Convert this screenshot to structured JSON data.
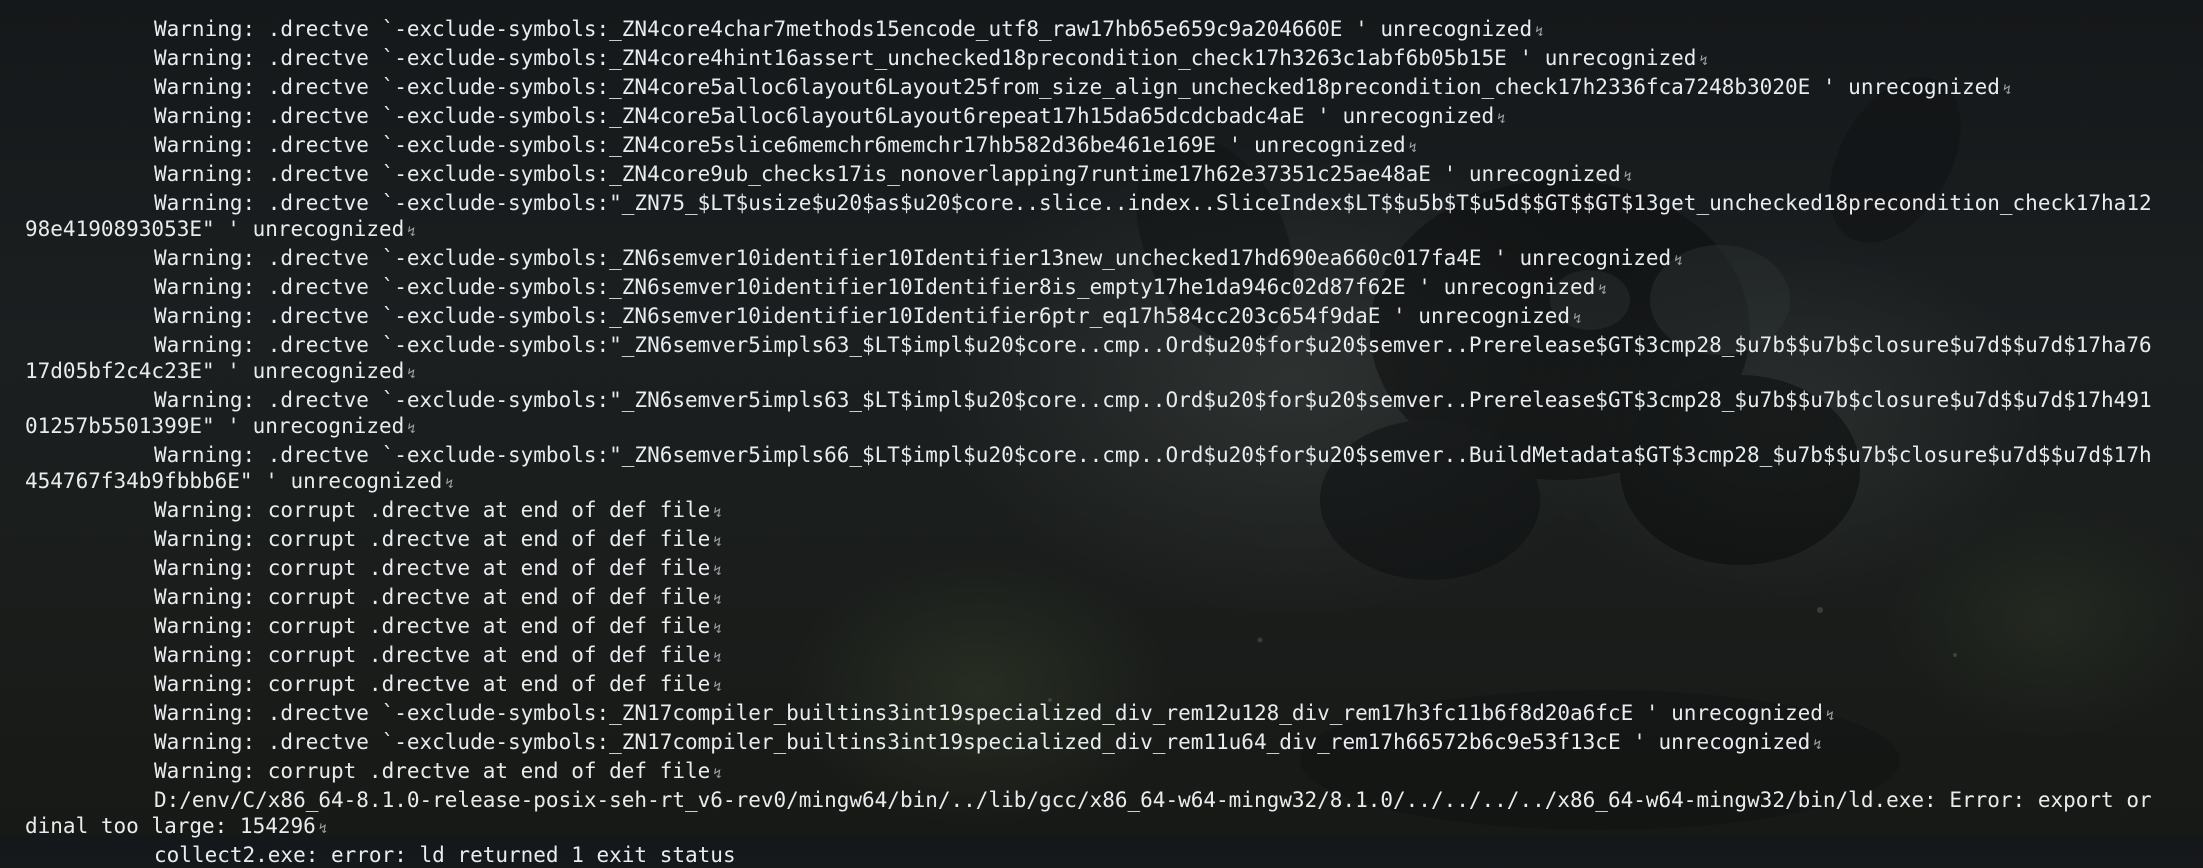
{
  "terminal": {
    "lines": [
      {
        "text": "Warning: .drectve `-exclude-symbols:_ZN4core4char7methods15encode_utf8_raw17hb65e659c9a204660E ' unrecognized",
        "eol": "↯"
      },
      {
        "text": "Warning: .drectve `-exclude-symbols:_ZN4core4hint16assert_unchecked18precondition_check17h3263c1abf6b05b15E ' unrecognized",
        "eol": "↯"
      },
      {
        "text": "Warning: .drectve `-exclude-symbols:_ZN4core5alloc6layout6Layout25from_size_align_unchecked18precondition_check17h2336fca7248b3020E ' unrecognized",
        "eol": "↯"
      },
      {
        "text": "Warning: .drectve `-exclude-symbols:_ZN4core5alloc6layout6Layout6repeat17h15da65dcdcbadc4aE ' unrecognized",
        "eol": "↯"
      },
      {
        "text": "Warning: .drectve `-exclude-symbols:_ZN4core5slice6memchr6memchr17hb582d36be461e169E ' unrecognized",
        "eol": "↯"
      },
      {
        "text": "Warning: .drectve `-exclude-symbols:_ZN4core9ub_checks17is_nonoverlapping7runtime17h62e37351c25ae48aE ' unrecognized",
        "eol": "↯"
      },
      {
        "text": "Warning: .drectve `-exclude-symbols:\"_ZN75_$LT$usize$u20$as$u20$core..slice..index..SliceIndex$LT$$u5b$T$u5d$$GT$$GT$13get_unchecked18precondition_check17ha1298e4190893053E\" ' unrecognized",
        "eol": "↯"
      },
      {
        "text": "Warning: .drectve `-exclude-symbols:_ZN6semver10identifier10Identifier13new_unchecked17hd690ea660c017fa4E ' unrecognized",
        "eol": "↯"
      },
      {
        "text": "Warning: .drectve `-exclude-symbols:_ZN6semver10identifier10Identifier8is_empty17he1da946c02d87f62E ' unrecognized",
        "eol": "↯"
      },
      {
        "text": "Warning: .drectve `-exclude-symbols:_ZN6semver10identifier10Identifier6ptr_eq17h584cc203c654f9daE ' unrecognized",
        "eol": "↯"
      },
      {
        "text": "Warning: .drectve `-exclude-symbols:\"_ZN6semver5impls63_$LT$impl$u20$core..cmp..Ord$u20$for$u20$semver..Prerelease$GT$3cmp28_$u7b$$u7b$closure$u7d$$u7d$17ha7617d05bf2c4c23E\" ' unrecognized",
        "eol": "↯"
      },
      {
        "text": "Warning: .drectve `-exclude-symbols:\"_ZN6semver5impls63_$LT$impl$u20$core..cmp..Ord$u20$for$u20$semver..Prerelease$GT$3cmp28_$u7b$$u7b$closure$u7d$$u7d$17h49101257b5501399E\" ' unrecognized",
        "eol": "↯"
      },
      {
        "text": "Warning: .drectve `-exclude-symbols:\"_ZN6semver5impls66_$LT$impl$u20$core..cmp..Ord$u20$for$u20$semver..BuildMetadata$GT$3cmp28_$u7b$$u7b$closure$u7d$$u7d$17h454767f34b9fbbb6E\" ' unrecognized",
        "eol": "↯"
      },
      {
        "text": "Warning: corrupt .drectve at end of def file",
        "eol": "↯"
      },
      {
        "text": "Warning: corrupt .drectve at end of def file",
        "eol": "↯"
      },
      {
        "text": "Warning: corrupt .drectve at end of def file",
        "eol": "↯"
      },
      {
        "text": "Warning: corrupt .drectve at end of def file",
        "eol": "↯"
      },
      {
        "text": "Warning: corrupt .drectve at end of def file",
        "eol": "↯"
      },
      {
        "text": "Warning: corrupt .drectve at end of def file",
        "eol": "↯"
      },
      {
        "text": "Warning: corrupt .drectve at end of def file",
        "eol": "↯"
      },
      {
        "text": "Warning: .drectve `-exclude-symbols:_ZN17compiler_builtins3int19specialized_div_rem12u128_div_rem17h3fc11b6f8d20a6fcE ' unrecognized",
        "eol": "↯"
      },
      {
        "text": "Warning: .drectve `-exclude-symbols:_ZN17compiler_builtins3int19specialized_div_rem11u64_div_rem17h66572b6c9e53f13cE ' unrecognized",
        "eol": "↯"
      },
      {
        "text": "Warning: corrupt .drectve at end of def file",
        "eol": "↯"
      },
      {
        "text": "D:/env/C/x86_64-8.1.0-release-posix-seh-rt_v6-rev0/mingw64/bin/../lib/gcc/x86_64-w64-mingw32/8.1.0/../../../../x86_64-w64-mingw32/bin/ld.exe: Error: export ordinal too large: 154296",
        "eol": "↯"
      },
      {
        "text": "collect2.exe: error: ld returned 1 exit status",
        "eol": ""
      }
    ]
  }
}
